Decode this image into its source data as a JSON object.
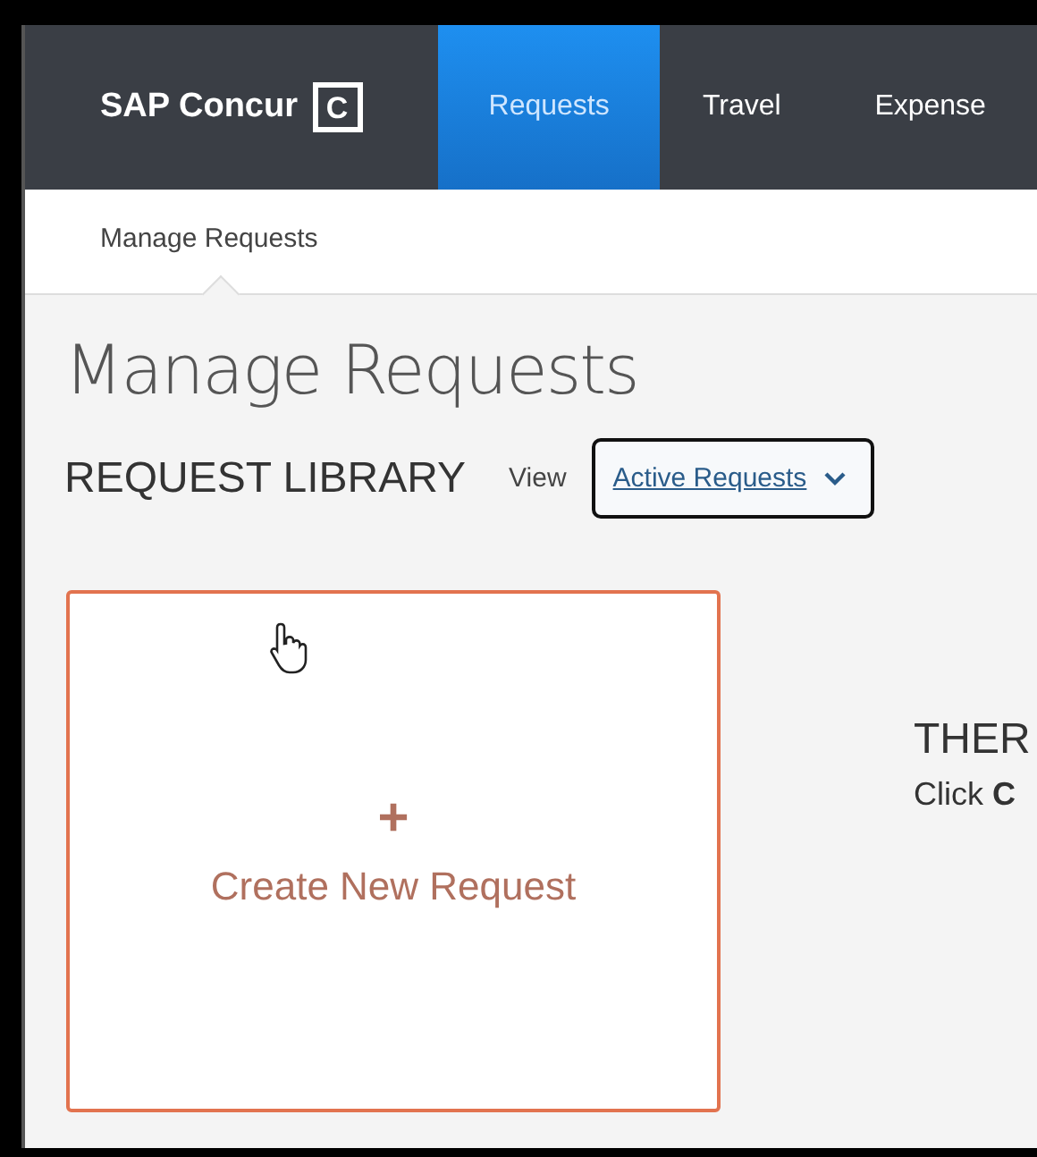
{
  "brand": {
    "name": "SAP Concur",
    "mark": "C"
  },
  "nav_tabs": [
    {
      "label": "Requests",
      "selected": true
    },
    {
      "label": "Travel",
      "selected": false
    },
    {
      "label": "Expense",
      "selected": false
    }
  ],
  "subnav": [
    {
      "label": "Manage Requests",
      "selected": true
    }
  ],
  "page_title": "Manage Requests",
  "library": {
    "heading": "REQUEST LIBRARY",
    "view_label": "View",
    "view_value": "Active Requests"
  },
  "create_card": {
    "icon": "+",
    "label": "Create New Request"
  },
  "empty_state": {
    "heading": "THER",
    "hint": "Click **C**"
  }
}
